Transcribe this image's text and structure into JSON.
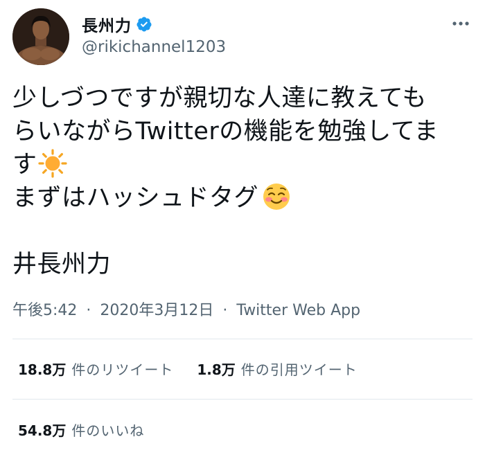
{
  "user": {
    "display_name": "長州力",
    "handle": "@rikichannel1203",
    "verified_icon": "verified-badge-icon"
  },
  "header": {
    "more_icon": "more-horizontal-icon"
  },
  "tweet": {
    "line1": "少しづつですが親切な人達に教えても",
    "line2": "らいながらTwitterの機能を勉強してま",
    "line3": "す",
    "line4": "まずはハッシュドタグ",
    "line5": "井長州力",
    "emoji_sun": "sun-emoji-icon",
    "emoji_smile": "smiling-face-emoji-icon"
  },
  "meta": {
    "time": "午後5:42",
    "separator": "·",
    "date": "2020年3月12日",
    "source": "Twitter Web App"
  },
  "stats": {
    "retweets_count": "18.8万",
    "retweets_label": "件のリツイート",
    "quotes_count": "1.8万",
    "quotes_label": "件の引用ツイート",
    "likes_count": "54.8万",
    "likes_label": "件のいいね"
  },
  "colors": {
    "text": "#0f1419",
    "secondary": "#536471",
    "verified": "#1d9bf0",
    "divider": "#e1e8ed"
  }
}
